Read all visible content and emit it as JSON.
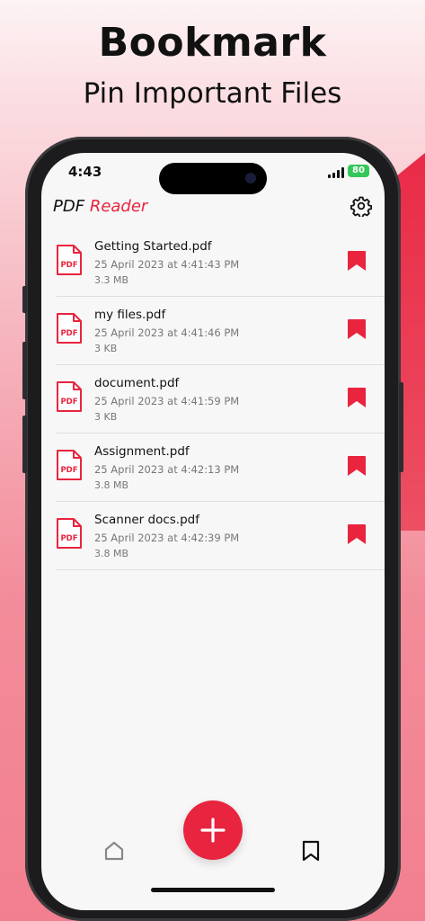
{
  "promo": {
    "title": "Bookmark",
    "subtitle": "Pin Important Files"
  },
  "status_bar": {
    "time": "4:43",
    "battery": "80"
  },
  "header": {
    "brand_prefix": "PDF",
    "brand_suffix": "Reader",
    "settings_icon": "gear-icon"
  },
  "files": [
    {
      "name": "Getting Started.pdf",
      "date": "25 April 2023 at 4:41:43 PM",
      "size": "3.3 MB",
      "badge": "PDF"
    },
    {
      "name": "my files.pdf",
      "date": "25 April 2023 at 4:41:46 PM",
      "size": "3 KB",
      "badge": "PDF"
    },
    {
      "name": "document.pdf",
      "date": "25 April 2023 at 4:41:59 PM",
      "size": "3 KB",
      "badge": "PDF"
    },
    {
      "name": "Assignment.pdf",
      "date": "25 April 2023 at 4:42:13 PM",
      "size": "3.8 MB",
      "badge": "PDF"
    },
    {
      "name": "Scanner docs.pdf",
      "date": "25 April 2023 at 4:42:39 PM",
      "size": "3.8 MB",
      "badge": "PDF"
    }
  ],
  "bottom_nav": {
    "home_icon": "home-icon",
    "add_icon": "plus-icon",
    "bookmarks_icon": "bookmark-icon"
  },
  "colors": {
    "accent": "#e8243f",
    "battery": "#34c759"
  }
}
